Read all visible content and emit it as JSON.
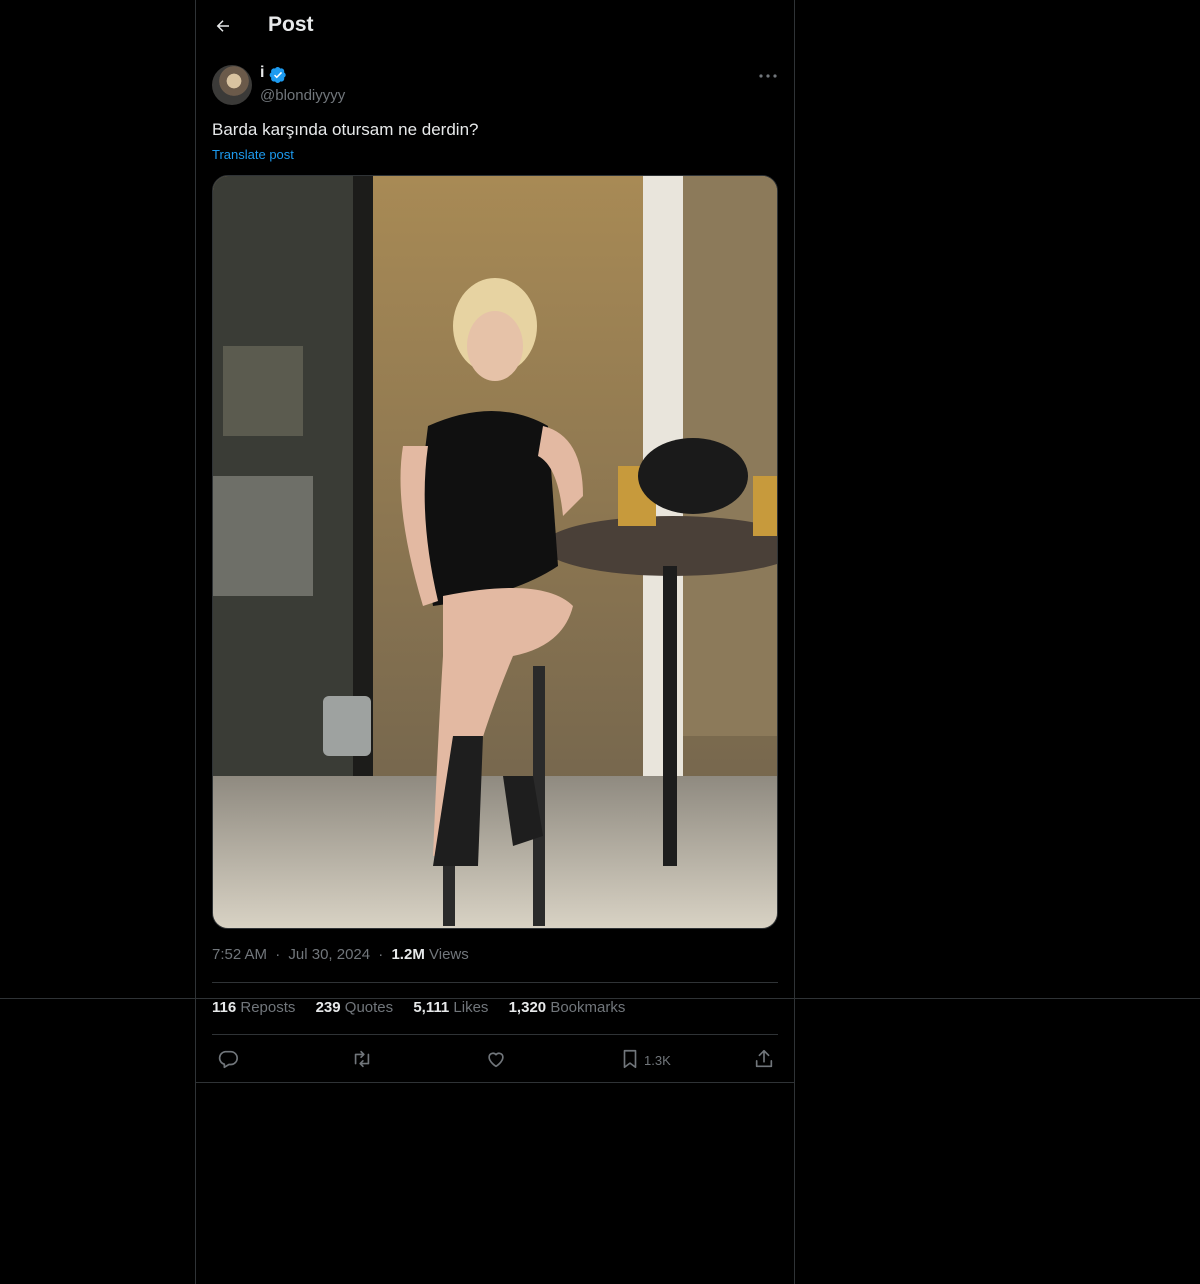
{
  "header": {
    "title": "Post",
    "back_icon": "arrow-left-icon"
  },
  "post": {
    "display_name": "i",
    "handle": "@blondiyyyy",
    "verified": true,
    "text": "Barda karşında otursam ne derdin?",
    "translate_label": "Translate post",
    "time": "7:52 AM",
    "date": "Jul 30, 2024",
    "views_count": "1.2M",
    "views_label": "Views",
    "sep": "·"
  },
  "stats": {
    "reposts": {
      "count": "116",
      "label": "Reposts"
    },
    "quotes": {
      "count": "239",
      "label": "Quotes"
    },
    "likes": {
      "count": "5,111",
      "label": "Likes"
    },
    "bookmarks": {
      "count": "1,320",
      "label": "Bookmarks"
    }
  },
  "actions": {
    "bookmark_count": "1.3K",
    "icons": [
      "reply-icon",
      "repost-icon",
      "like-icon",
      "bookmark-icon",
      "share-icon"
    ]
  },
  "colors": {
    "background": "#000000",
    "text": "#e7e9ea",
    "muted": "#71767b",
    "accent": "#1d9bf0",
    "border": "#2f3336"
  }
}
